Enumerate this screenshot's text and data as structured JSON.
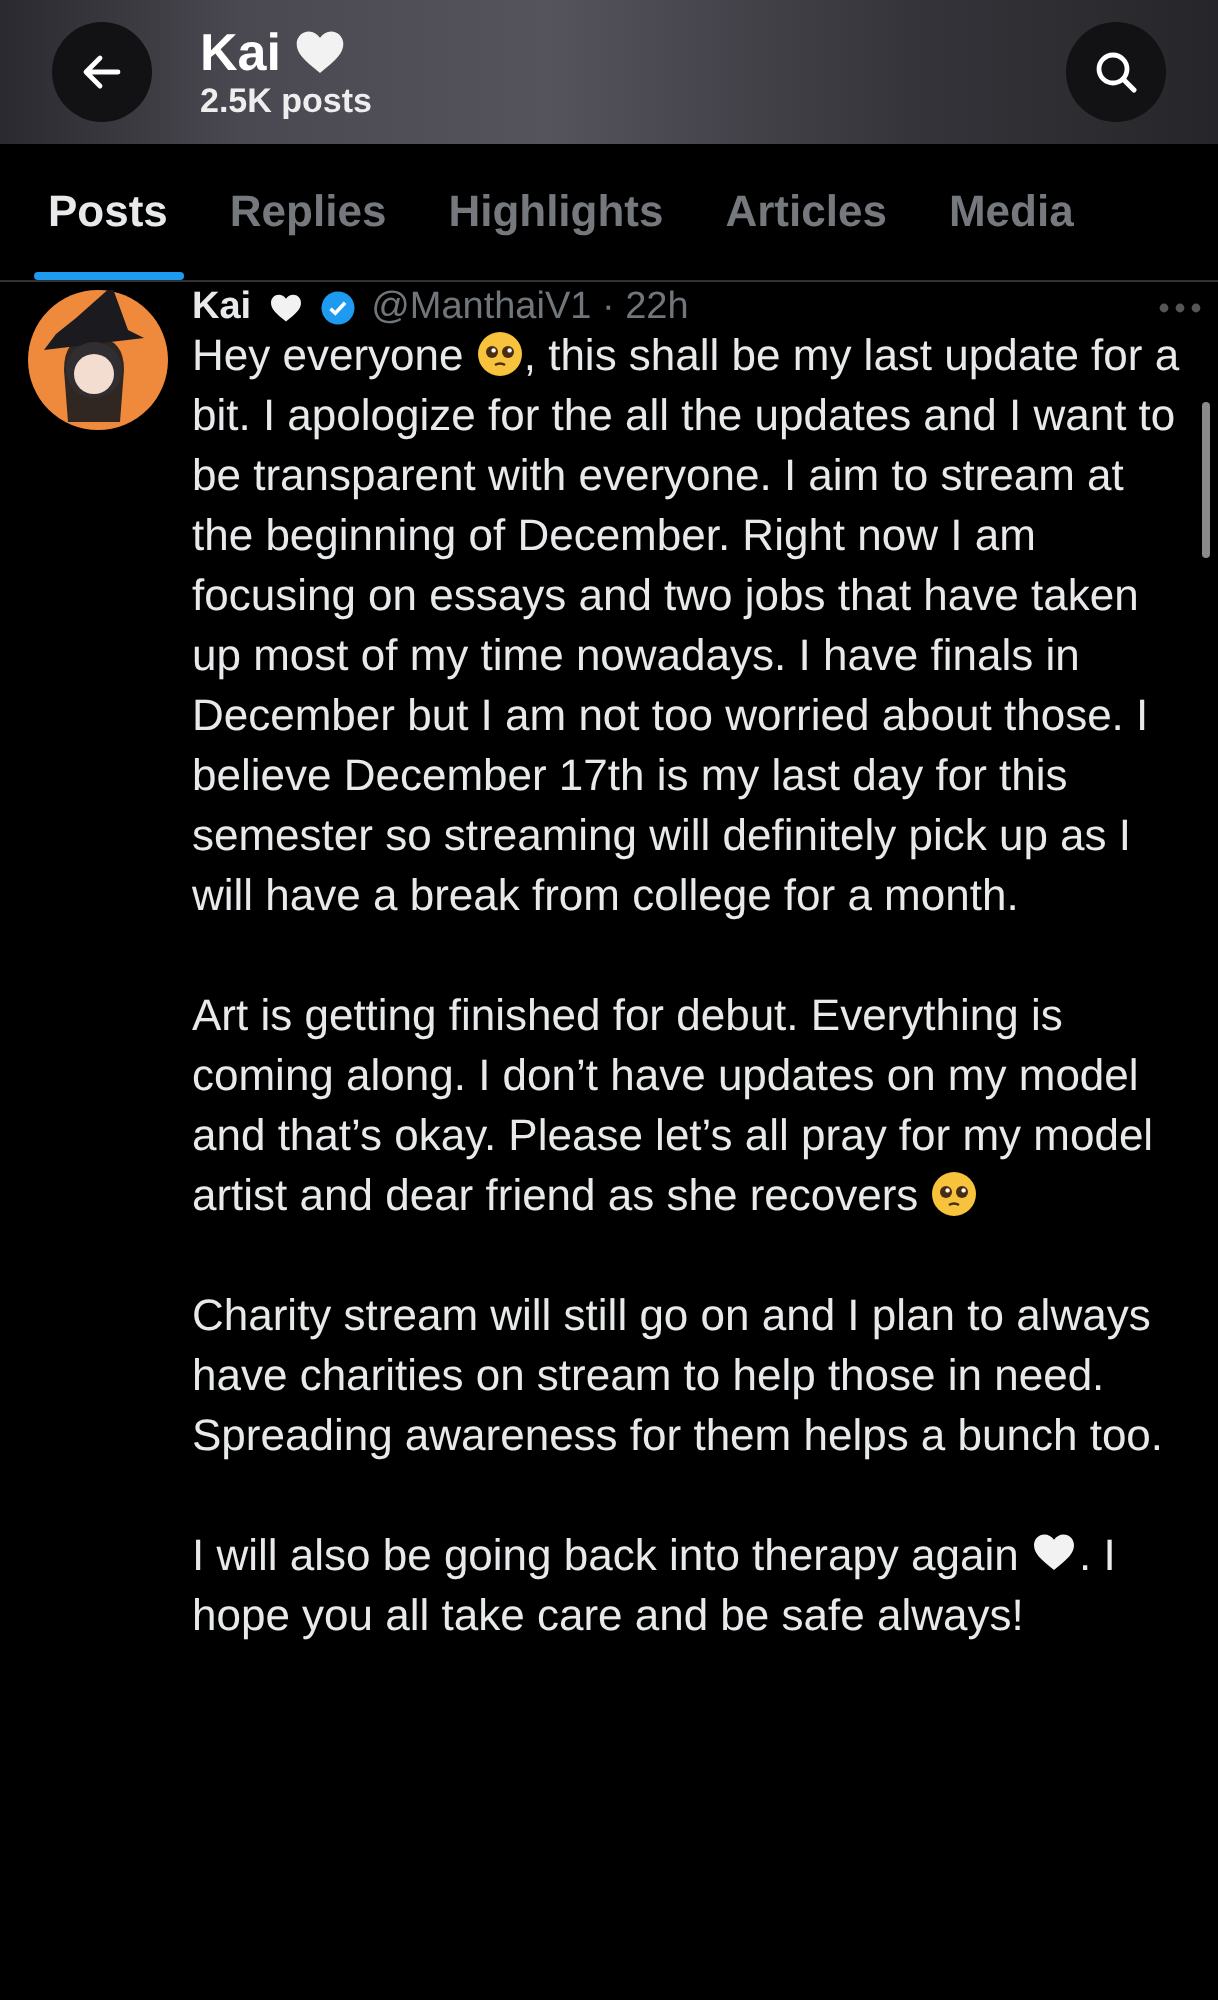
{
  "header": {
    "title": "Kai",
    "post_count": "2.5K posts"
  },
  "tabs": [
    {
      "label": "Posts",
      "selected": true
    },
    {
      "label": "Replies",
      "selected": false
    },
    {
      "label": "Highlights",
      "selected": false
    },
    {
      "label": "Articles",
      "selected": false
    },
    {
      "label": "Media",
      "selected": false
    }
  ],
  "post": {
    "author": "Kai",
    "verified": true,
    "handle_time": "@ManthaiV1 · 22h",
    "paragraphs": [
      [
        {
          "kind": "text",
          "text": "Hey everyone "
        },
        {
          "kind": "pleading"
        },
        {
          "kind": "text",
          "text": ", this shall be my last update for a bit. I apologize for the all the updates and I want to be transparent with everyone. I aim to stream at the beginning of December. Right now I am focusing on essays and two jobs that have taken up most of my time nowadays. I have finals in December but I am not too worried about those. I believe December 17th is my last day for this semester so streaming will definitely pick up as I will have a break from college for a month."
        }
      ],
      [
        {
          "kind": "text",
          "text": "Art is getting finished for debut. Everything is coming along. I don’t have updates on my model and that’s okay. Please let’s all pray for my model artist and dear friend as she recovers "
        },
        {
          "kind": "pleading"
        }
      ],
      [
        {
          "kind": "text",
          "text": "Charity stream will still go on and I plan to always have charities on stream to help those in need. Spreading awareness for them helps a bunch too."
        }
      ],
      [
        {
          "kind": "text",
          "text": "I will also be going back into therapy again "
        },
        {
          "kind": "heart"
        },
        {
          "kind": "text",
          "text": ". I hope you all take care and be safe always!"
        }
      ]
    ]
  }
}
